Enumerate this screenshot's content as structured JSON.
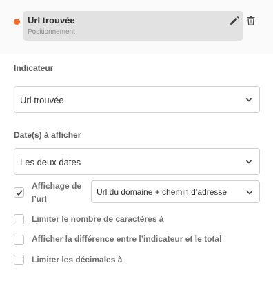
{
  "colors": {
    "status_dot": "#f26b2a",
    "card_bg": "#e2e2e2"
  },
  "metric_card": {
    "title": "Url trouvée",
    "subtitle": "Positionnement",
    "edit_icon": "pencil-icon",
    "delete_icon": "trash-icon"
  },
  "indicator": {
    "label": "Indicateur",
    "selected": "Url trouvée"
  },
  "dates": {
    "label": "Date(s) à afficher",
    "selected": "Les deux dates"
  },
  "url_display": {
    "label_line1": "Affichage de",
    "label_line2": "l’url",
    "checked": true,
    "selected": "Url du domaine + chemin d’adresse"
  },
  "options": [
    {
      "label": "Limiter le nombre de caractères à",
      "checked": false
    },
    {
      "label": "Afficher la différence entre l’indicateur et le total",
      "checked": false
    },
    {
      "label": "Limiter les décimales à",
      "checked": false
    }
  ]
}
